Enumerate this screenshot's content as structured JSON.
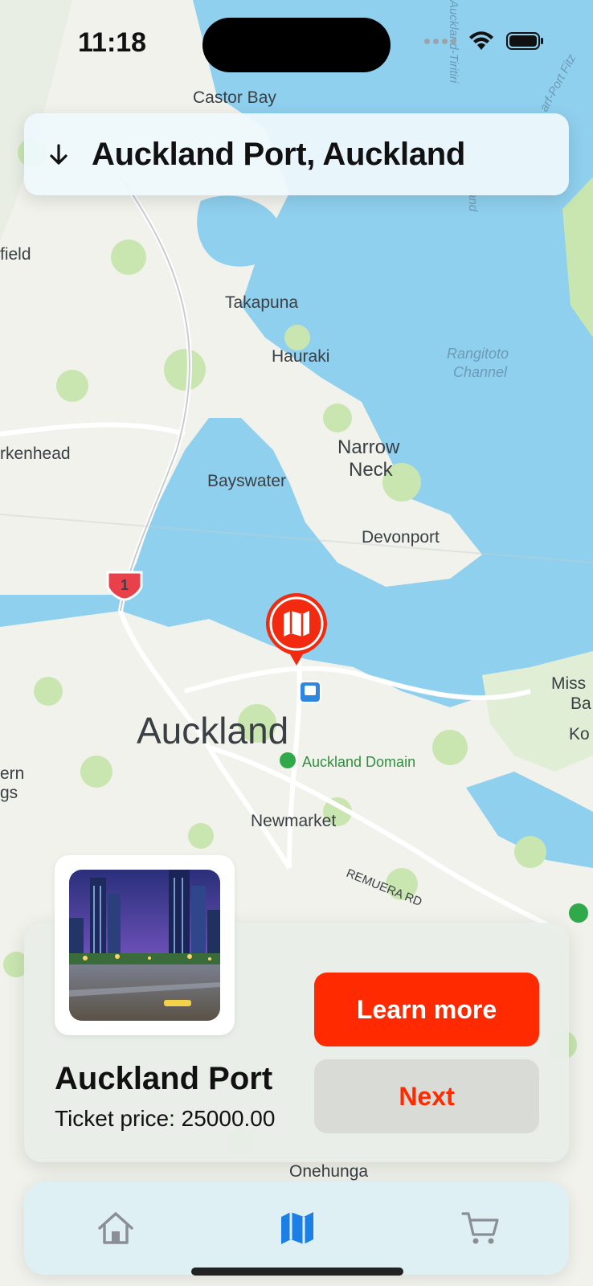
{
  "status_bar": {
    "time": "11:18"
  },
  "location_header": {
    "title": "Auckland Port, Auckland",
    "arrow_icon": "arrow-down-icon"
  },
  "map": {
    "labels": {
      "castor_bay": "Castor Bay",
      "field": "field",
      "takapuna": "Takapuna",
      "hauraki": "Hauraki",
      "rangitoto1": "Rangitoto",
      "rangitoto2": "Channel",
      "birkenhead": "rkenhead",
      "narrow1": "Narrow",
      "narrow2": "Neck",
      "bayswater": "Bayswater",
      "devonport": "Devonport",
      "auckland": "Auckland",
      "auckland_domain": "Auckland Domain",
      "newmarket": "Newmarket",
      "remuera": "REMUERA RD",
      "onehunga": "Onehunga",
      "missbay1": "Miss",
      "missbay2": "Ba",
      "ko": "Ko",
      "ern": "ern",
      "gs": "gs",
      "aucktiri": "Auckland-Tiritiri",
      "and": "and",
      "harfport": "arf-Port Fitz",
      "route": "1"
    },
    "pin_icon": "map-icon"
  },
  "place_card": {
    "name": "Auckland Port",
    "price": "Ticket price: 25000.00",
    "learn_more": "Learn more",
    "next": "Next"
  },
  "tab_bar": {
    "tabs": [
      {
        "icon": "home-icon",
        "active": false
      },
      {
        "icon": "map-icon",
        "active": true
      },
      {
        "icon": "cart-icon",
        "active": false
      }
    ]
  },
  "colors": {
    "accent": "#ff2a00",
    "tab_active": "#1c7fe6",
    "tab_inactive": "#8a8f94",
    "water": "#8fd0ee",
    "land": "#f2f2ec",
    "park": "#c9e6b0"
  }
}
